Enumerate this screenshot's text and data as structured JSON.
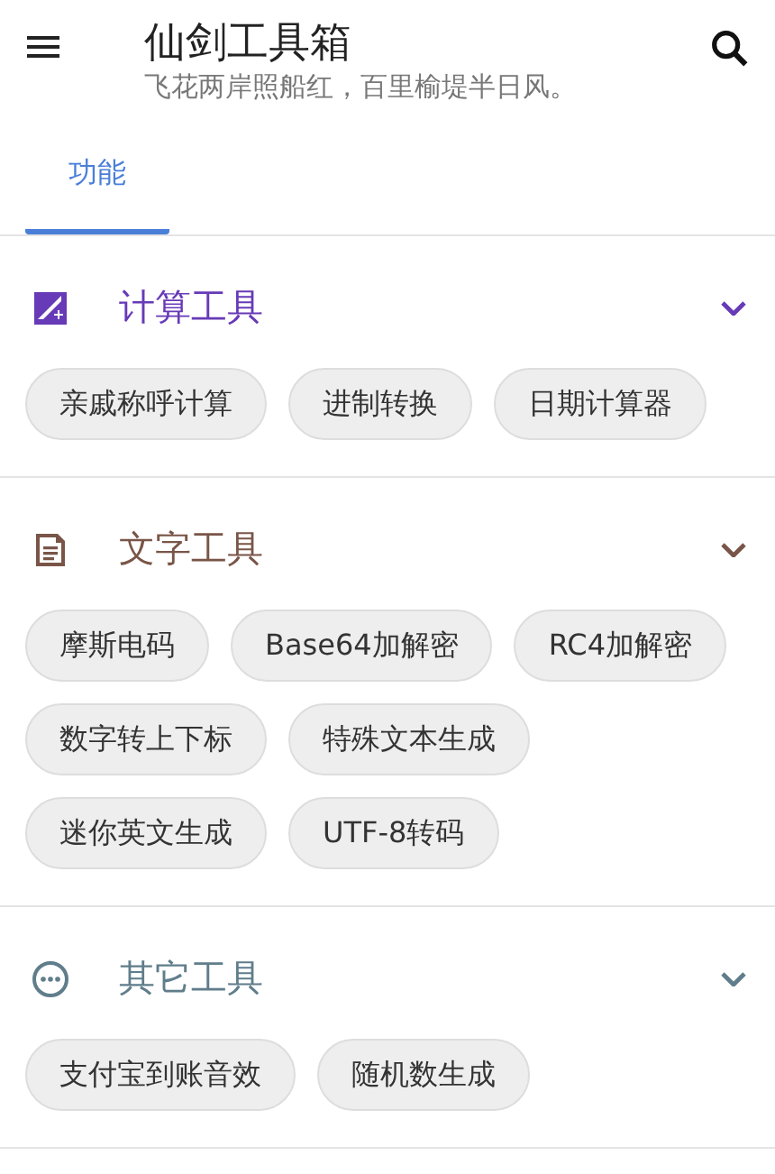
{
  "app_bar": {
    "title": "仙剑工具箱",
    "subtitle": "飞花两岸照船红，百里榆堤半日风。"
  },
  "tabs": [
    {
      "label": "功能",
      "selected": true
    }
  ],
  "sections": [
    {
      "kind": "calculator",
      "title": "计算工具",
      "color": "#673ab7",
      "expanded": true,
      "chips": [
        "亲戚称呼计算",
        "进制转换",
        "日期计算器"
      ]
    },
    {
      "kind": "document",
      "title": "文字工具",
      "color": "#795548",
      "expanded": true,
      "chips": [
        "摩斯电码",
        "Base64加解密",
        "RC4加解密",
        "数字转上下标",
        "特殊文本生成",
        "迷你英文生成",
        "UTF-8转码"
      ]
    },
    {
      "kind": "more",
      "title": "其它工具",
      "color": "#607d8b",
      "expanded": true,
      "chips": [
        "支付宝到账音效",
        "随机数生成"
      ]
    }
  ]
}
